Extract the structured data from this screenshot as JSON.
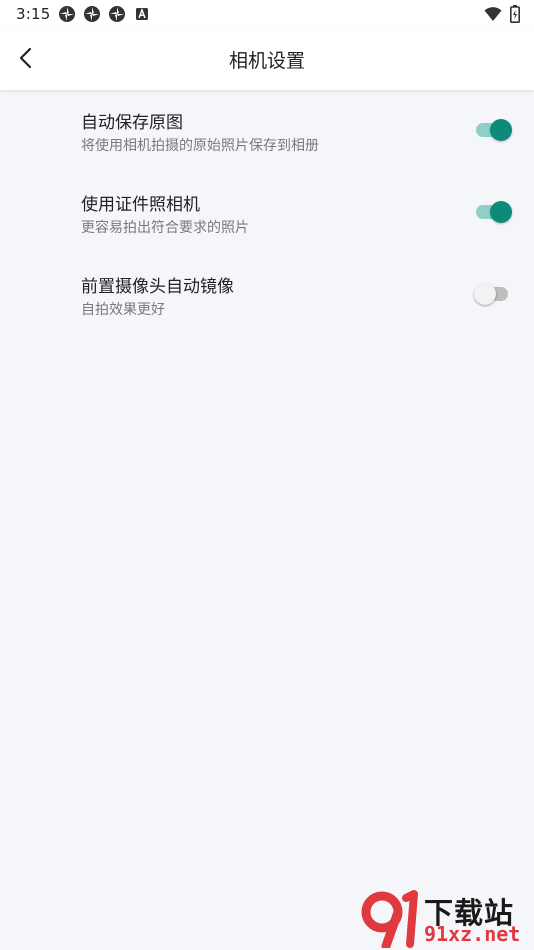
{
  "status_bar": {
    "time": "3:15",
    "left_icons": [
      "notification-icon",
      "notification-icon",
      "notification-icon",
      "text-a-icon"
    ],
    "right_icons": [
      "wifi-icon",
      "battery-icon"
    ]
  },
  "app_bar": {
    "back_icon": "chevron-left-icon",
    "title": "相机设置"
  },
  "settings": [
    {
      "title": "自动保存原图",
      "description": "将使用相机拍摄的原始照片保存到相册",
      "enabled": true
    },
    {
      "title": "使用证件照相机",
      "description": "更容易拍出符合要求的照片",
      "enabled": true
    },
    {
      "title": "前置摄像头自动镜像",
      "description": "自拍效果更好",
      "enabled": false
    }
  ],
  "watermark": {
    "brand_top": "下载站",
    "brand_bottom": "91xz.net"
  },
  "colors": {
    "accent": "#0e8a7b",
    "accent_track": "#8fcfc7",
    "background": "#f5f6fa",
    "watermark_red": "#e0393e"
  }
}
